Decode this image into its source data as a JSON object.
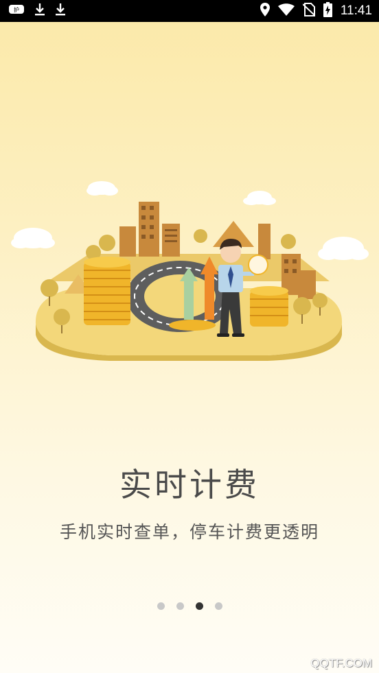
{
  "status_bar": {
    "time": "11:41",
    "left_icons": [
      "app-notification-icon",
      "download-icon",
      "download-icon"
    ],
    "right_icons": [
      "location-icon",
      "wifi-icon",
      "no-sim-icon",
      "battery-charging-icon"
    ]
  },
  "onboarding": {
    "title": "实时计费",
    "subtitle": "手机实时查单，停车计费更透明",
    "page_count": 4,
    "active_page": 3,
    "illustration": "city-parking-billing-illustration"
  },
  "watermark": "QQTF.COM",
  "colors": {
    "background_top": "#fbe9a8",
    "background_bottom": "#fffdf6",
    "accent_gold": "#f1c232",
    "dot_active": "#333333",
    "dot_inactive": "#c8c8c8"
  }
}
